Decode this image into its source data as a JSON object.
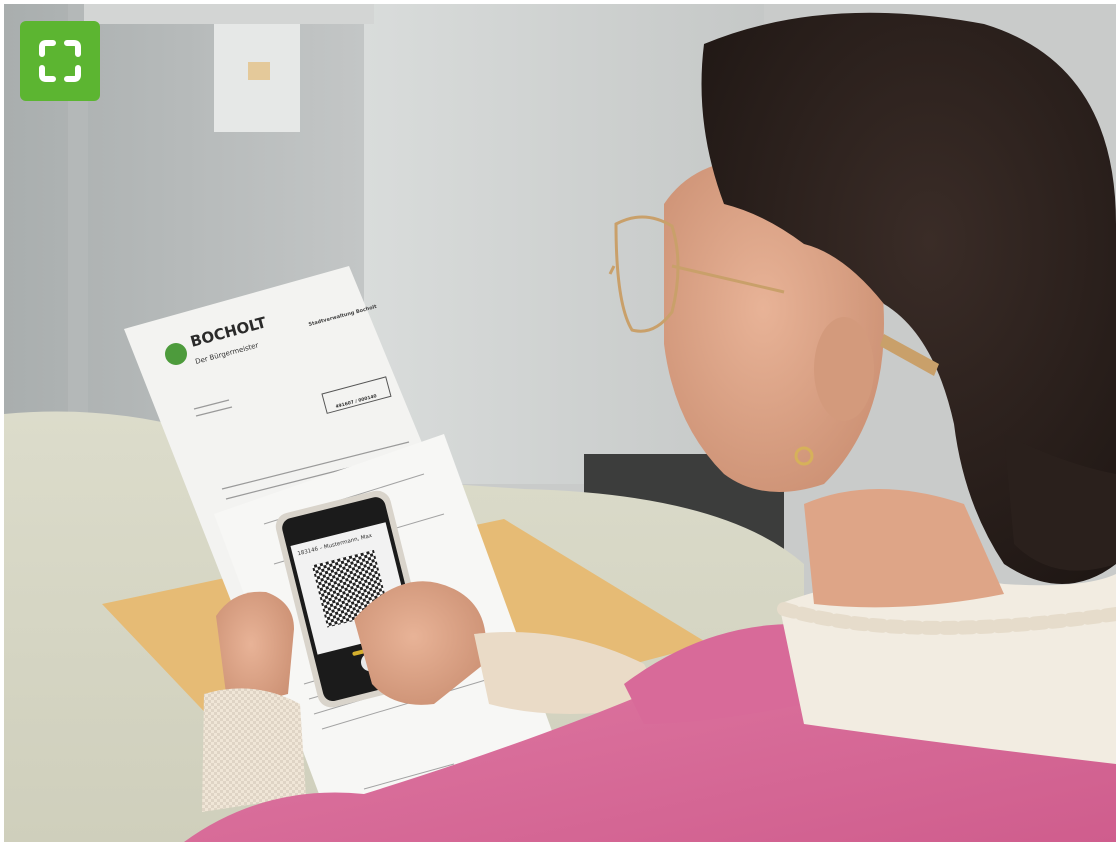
{
  "image": {
    "alt": "",
    "document": {
      "brand": "BOCHOLT",
      "subtitle": "Der Bürgermeister",
      "heading": "Stadtverwaltung Bocholt",
      "reference": "491607 / 000140"
    },
    "phone_screen_label": "183146 – Mustermann, Max"
  },
  "controls": {
    "fullscreen_icon": "expand-corners-icon",
    "fullscreen_color": "#5cb531"
  }
}
